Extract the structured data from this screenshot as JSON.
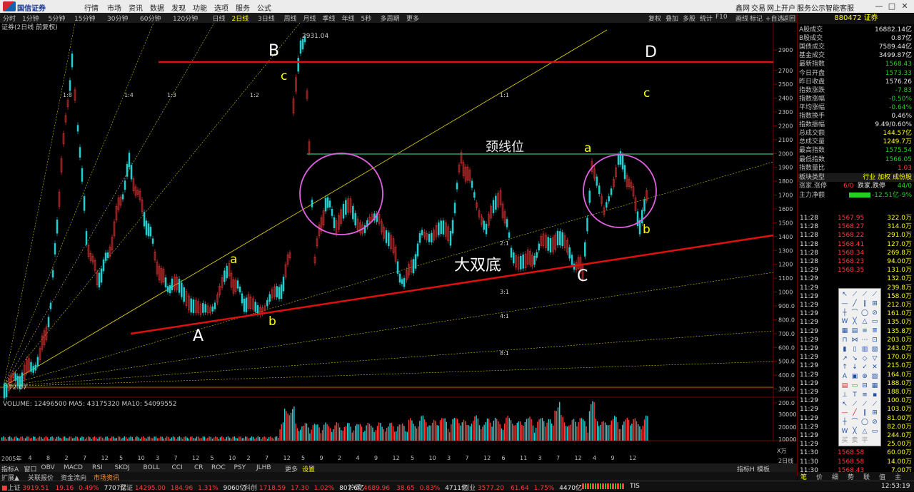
{
  "app": {
    "brand": "国信证券"
  },
  "menu": [
    "行情",
    "市场",
    "资讯",
    "数据",
    "发现",
    "功能",
    "选项",
    "服务",
    "公式"
  ],
  "top_right_links": [
    "鑫网",
    "交易",
    "网上开户",
    "服务公示",
    "智能客服"
  ],
  "periods": [
    "分时",
    "1分钟",
    "5分钟",
    "15分钟",
    "30分钟",
    "60分钟",
    "120分钟",
    "日线",
    "2日线",
    "3日线",
    "周线",
    "月线",
    "季线",
    "年线",
    "5秒",
    "多周期",
    "更多"
  ],
  "active_period": "2日线",
  "right_tools": [
    "复权",
    "叠加",
    "多股",
    "统计",
    "F10",
    "画线",
    "标记",
    "+自选",
    "返回"
  ],
  "chart_title": "证券(2日线 前复权)",
  "price_labels": {
    "high": "2931.04",
    "low": "72.07"
  },
  "y_ticks": [
    "2900",
    "2700",
    "2500",
    "2400",
    "2300",
    "2200",
    "2100",
    "2000",
    "1900",
    "1800",
    "1700",
    "1600",
    "1500",
    "1400",
    "1300",
    "1200",
    "1100",
    "1000",
    "900.0",
    "800.0",
    "700.0",
    "600.0",
    "500.0",
    "400.0",
    "300.0",
    "200.0"
  ],
  "annotations": {
    "B": "B",
    "D": "D",
    "A": "A",
    "C": "C",
    "c1": "c",
    "c2": "c",
    "a1": "a",
    "a2": "a",
    "b1": "b",
    "b2": "b",
    "neckline": "颈线位",
    "double_bottom": "大双底"
  },
  "gann_labels": [
    "1:8",
    "1:4",
    "1:3",
    "1:2",
    "1:1",
    "2:1",
    "3:1",
    "4:1",
    "8:1"
  ],
  "volume": {
    "header": "VOLUME: 12496500  MA5: 43175320  MA10: 54099552",
    "ticks": [
      "30000",
      "20000",
      "10000"
    ],
    "unit": "X万"
  },
  "x_axis": [
    "2005年",
    "4",
    "8",
    "2",
    "7",
    "12",
    "5",
    "10",
    "3",
    "7",
    "12",
    "5",
    "10",
    "2",
    "7",
    "12",
    "5",
    "9",
    "2",
    "4",
    "9",
    "12",
    "5",
    "10",
    "3",
    "7",
    "12",
    "6",
    "11",
    "3",
    "7",
    "12",
    "4",
    "9",
    "12"
  ],
  "indicator_tabs": [
    "指标A",
    "窗口",
    "OBV",
    "MACD",
    "RSI",
    "SKDJ",
    "BOLL",
    "CCI",
    "CR",
    "ROC",
    "PSY",
    "JLHB",
    "更多",
    "设置"
  ],
  "sub_tabs": [
    "扩展▲",
    "关联报价",
    "资金流向",
    "市场资讯"
  ],
  "bottom_right_tabs": [
    "指标H",
    "模板"
  ],
  "stock": {
    "code": "880472",
    "name": "证券"
  },
  "quote_rows": [
    {
      "label": "A股成交",
      "value": "16882.14亿",
      "color": "white"
    },
    {
      "label": "B股成交",
      "value": "0.87亿",
      "color": "white"
    },
    {
      "label": "国债成交",
      "value": "7589.44亿",
      "color": "white"
    },
    {
      "label": "基金成交",
      "value": "3499.87亿",
      "color": "white"
    },
    {
      "label": "最新指数",
      "value": "1568.43",
      "color": "green"
    },
    {
      "label": "今日开盘",
      "value": "1573.33",
      "color": "green"
    },
    {
      "label": "昨日收盘",
      "value": "1576.26",
      "color": "white"
    },
    {
      "label": "指数涨跌",
      "value": "-7.83",
      "color": "green"
    },
    {
      "label": "指数涨幅",
      "value": "-0.50%",
      "color": "green"
    },
    {
      "label": "平均涨幅",
      "value": "-0.64%",
      "color": "green"
    },
    {
      "label": "指数换手",
      "value": "0.46%",
      "color": "white"
    },
    {
      "label": "指数振幅",
      "value": "9.49/0.60%",
      "color": "white"
    },
    {
      "label": "总成交额",
      "value": "144.57亿",
      "color": "yellow"
    },
    {
      "label": "总成交量",
      "value": "1249.7万",
      "color": "yellow"
    },
    {
      "label": "最高指数",
      "value": "1575.54",
      "color": "green"
    },
    {
      "label": "最低指数",
      "value": "1566.05",
      "color": "green"
    },
    {
      "label": "指数量比",
      "value": "1.03",
      "color": "red"
    }
  ],
  "sector": {
    "label": "板块类型",
    "value": "行业 加权 成份股"
  },
  "updown": {
    "label1": "涨家.涨停",
    "val1": "6/0",
    "label2": "跌家.跌停",
    "val2": "44/0"
  },
  "mainflow": {
    "label": "主力净额",
    "value": "-12.51亿",
    "pct": "-9%"
  },
  "ticks": [
    {
      "t": "11:28",
      "p": "1567.95",
      "v": "322.0万"
    },
    {
      "t": "11:28",
      "p": "1568.27",
      "v": "314.0万"
    },
    {
      "t": "11:28",
      "p": "1568.22",
      "v": "291.0万"
    },
    {
      "t": "11:28",
      "p": "1568.41",
      "v": "127.0万"
    },
    {
      "t": "11:28",
      "p": "1568.34",
      "v": "269.8万"
    },
    {
      "t": "11:28",
      "p": "1568.23",
      "v": "94.00万"
    },
    {
      "t": "11:29",
      "p": "1568.35",
      "v": "131.0万"
    },
    {
      "t": "11:29",
      "p": "",
      "v": "132.0万"
    },
    {
      "t": "11:29",
      "p": "",
      "v": "239.8万"
    },
    {
      "t": "11:29",
      "p": "",
      "v": "158.0万"
    },
    {
      "t": "11:29",
      "p": "",
      "v": "212.0万"
    },
    {
      "t": "11:29",
      "p": "",
      "v": "161.0万"
    },
    {
      "t": "11:29",
      "p": "",
      "v": "135.0万"
    },
    {
      "t": "11:29",
      "p": "",
      "v": "135.8万"
    },
    {
      "t": "11:29",
      "p": "",
      "v": "203.0万"
    },
    {
      "t": "11:29",
      "p": "",
      "v": "243.0万"
    },
    {
      "t": "11:29",
      "p": "",
      "v": "170.0万"
    },
    {
      "t": "11:29",
      "p": "",
      "v": "215.0万"
    },
    {
      "t": "11:29",
      "p": "",
      "v": "164.0万"
    },
    {
      "t": "11:29",
      "p": "",
      "v": "188.0万"
    },
    {
      "t": "11:29",
      "p": "",
      "v": "188.0万"
    },
    {
      "t": "11:29",
      "p": "",
      "v": "100.0万"
    },
    {
      "t": "11:29",
      "p": "",
      "v": "103.0万"
    },
    {
      "t": "11:29",
      "p": "",
      "v": "81.00万"
    },
    {
      "t": "11:29",
      "p": "",
      "v": "82.00万"
    },
    {
      "t": "11:29",
      "p": "",
      "v": "244.0万"
    },
    {
      "t": "11:29",
      "p": "",
      "v": "25.00万"
    },
    {
      "t": "11:30",
      "p": "1568.58",
      "v": "60.00万"
    },
    {
      "t": "11:30",
      "p": "1568.58",
      "v": "14.00万"
    },
    {
      "t": "11:30",
      "p": "1568.43",
      "v": "7.00万"
    }
  ],
  "rp_bottom_tabs": [
    "笔",
    "价",
    "细",
    "势",
    "联",
    "值",
    "主"
  ],
  "rp_bottom_range": "2日线",
  "status": {
    "sh": {
      "name": "上证",
      "val": "3919.51",
      "chg": "19.16",
      "pct": "0.49%",
      "amt": "7707亿"
    },
    "sz": {
      "name": "深证",
      "val": "14295.00",
      "chg": "184.96",
      "pct": "1.31%",
      "amt": "9060亿"
    },
    "kc": {
      "name": "科创",
      "val": "1718.59",
      "chg": "17.30",
      "pct": "1.02%",
      "amt": "807.6亿"
    },
    "hs": {
      "name": "沪深",
      "val": "4689.96",
      "chg": "38.65",
      "pct": "0.83%",
      "amt": "4711亿"
    },
    "cy": {
      "name": "创业",
      "val": "3577.20",
      "chg": "61.64",
      "pct": "1.75%",
      "amt": "4470亿"
    },
    "tis": "TIS",
    "time": "12:53:19"
  },
  "palette_rows": 16,
  "palette_footer": [
    "买",
    "卖",
    "平"
  ],
  "window_buttons": [
    "—",
    "□",
    "✕"
  ]
}
